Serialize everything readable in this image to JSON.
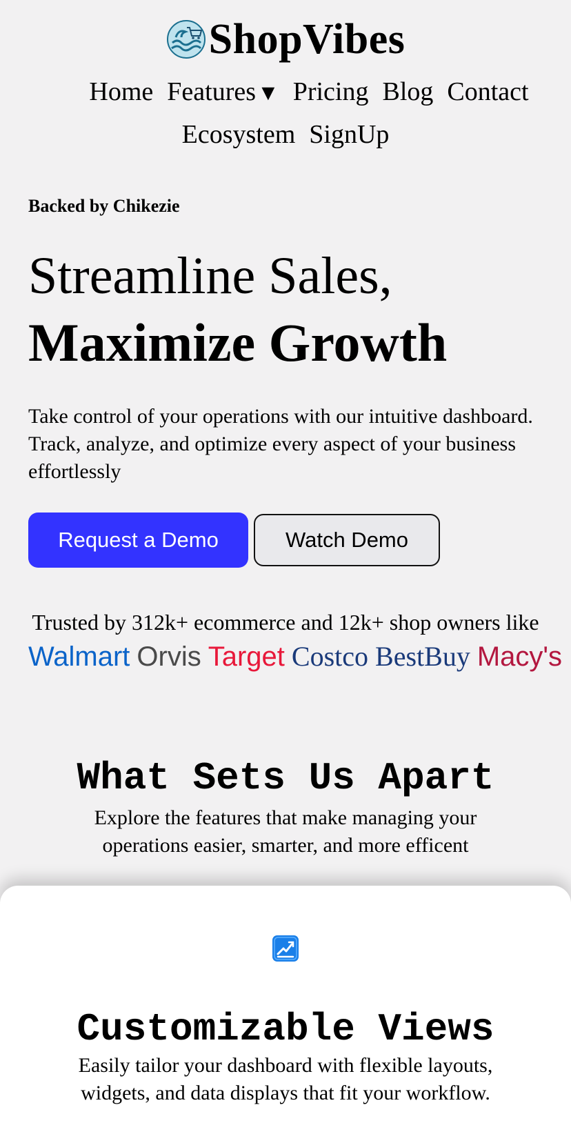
{
  "header": {
    "brand_name": "ShopVibes",
    "nav_row1": [
      "Home",
      "Features",
      "Pricing",
      "Blog",
      "Contact"
    ],
    "features_caret": "▼",
    "nav_row2": [
      "Ecosystem",
      "SignUp"
    ]
  },
  "hero": {
    "backed_by": "Backed by Chikezie",
    "headline_line1": "Streamline Sales,",
    "headline_line2": "Maximize Growth",
    "lead_line1": "Take control of your operations with our intuitive dashboard.",
    "lead_line2": "Track, analyze, and optimize every aspect of your business",
    "lead_line3": "effortlessly",
    "primary_button": "Request a Demo",
    "secondary_button": "Watch Demo"
  },
  "trust": {
    "text": "Trusted by 312k+ ecommerce and 12k+ shop owners like",
    "brands": [
      {
        "name": "Walmart",
        "color": "#0a63c9"
      },
      {
        "name": "Orvis",
        "color": "#4a4a4a"
      },
      {
        "name": "Target",
        "color": "#e8183a"
      },
      {
        "name": "Costco",
        "color": "#1a3a7a"
      },
      {
        "name": "BestBuy",
        "color": "#1a3a7a"
      },
      {
        "name": "Macy's",
        "color": "#b3173f"
      }
    ]
  },
  "features_section": {
    "title": "What Sets Us Apart",
    "subtitle_line1": "Explore the features that make managing your",
    "subtitle_line2": "operations easier, smarter, and more efficent"
  },
  "feature_card": {
    "icon": "chart-edit-icon",
    "title": "Customizable Views",
    "text_line1": "Easily tailor your dashboard with flexible layouts,",
    "text_line2": "widgets, and data displays that fit your workflow."
  },
  "colors": {
    "background": "#f2f1f2",
    "primary": "#3333ff",
    "card": "#ffffff"
  }
}
